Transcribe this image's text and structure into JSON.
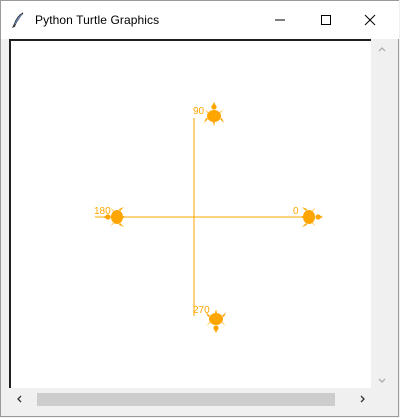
{
  "window": {
    "title": "Python Turtle Graphics",
    "app_icon": "feather-quill-icon",
    "controls": [
      "minimize-icon",
      "maximize-icon",
      "close-icon"
    ]
  },
  "canvas": {
    "background": "#ffffff",
    "line_color": "#ffa500",
    "turtle_color": "#ffa500",
    "labels": {
      "east": "0",
      "north": "90",
      "west": "180",
      "south": "270"
    }
  },
  "scrollbars": {
    "vertical": {
      "up_icon": "chevron-up-icon",
      "down_icon": "chevron-down-icon"
    },
    "horizontal": {
      "left_icon": "chevron-left-icon",
      "right_icon": "chevron-right-icon"
    }
  }
}
